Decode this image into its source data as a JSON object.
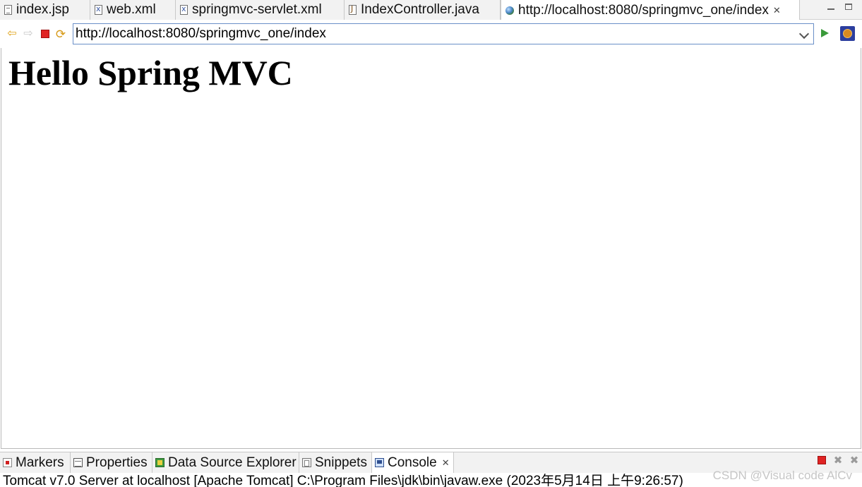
{
  "editor_tabs": [
    {
      "label": "index.jsp",
      "icon": "jsp-file-icon",
      "active": false
    },
    {
      "label": "web.xml",
      "icon": "xml-file-icon",
      "active": false
    },
    {
      "label": "springmvc-servlet.xml",
      "icon": "xml-file-icon",
      "active": false
    },
    {
      "label": "IndexController.java",
      "icon": "java-file-icon",
      "active": false
    },
    {
      "label": "http://localhost:8080/springmvc_one/index",
      "icon": "globe-icon",
      "active": true,
      "close_icon": "close-icon"
    }
  ],
  "window_controls": [
    "minimize-icon",
    "maximize-icon"
  ],
  "browser": {
    "url": "http://localhost:8080/springmvc_one/index",
    "buttons": [
      "back-arrow-icon",
      "forward-arrow-icon",
      "stop-icon",
      "refresh-icon",
      "go-icon",
      "eclipse-icon"
    ]
  },
  "page": {
    "heading": "Hello Spring MVC"
  },
  "view_tabs": [
    {
      "label": "Markers",
      "icon": "markers-icon",
      "active": false
    },
    {
      "label": "Properties",
      "icon": "properties-icon",
      "active": false
    },
    {
      "label": "Data Source Explorer",
      "icon": "data-source-icon",
      "active": false
    },
    {
      "label": "Snippets",
      "icon": "snippets-icon",
      "active": false
    },
    {
      "label": "Console",
      "icon": "console-icon",
      "active": true,
      "close_icon": "close-icon"
    }
  ],
  "console_actions": [
    "terminate-icon",
    "remove-launch-icon",
    "remove-all-terminated-icon"
  ],
  "console": {
    "status_line": "Tomcat v7.0 Server at localhost [Apache Tomcat] C:\\Program Files\\jdk\\bin\\javaw.exe (2023年5月14日 上午9:26:57)"
  },
  "watermark": "CSDN @Visual code AlCv",
  "colors": {
    "accent_border": "#6a8fc8",
    "stop_red": "#e02424",
    "go_green": "#3a9a3a",
    "panel_bg": "#f2f2f2"
  }
}
